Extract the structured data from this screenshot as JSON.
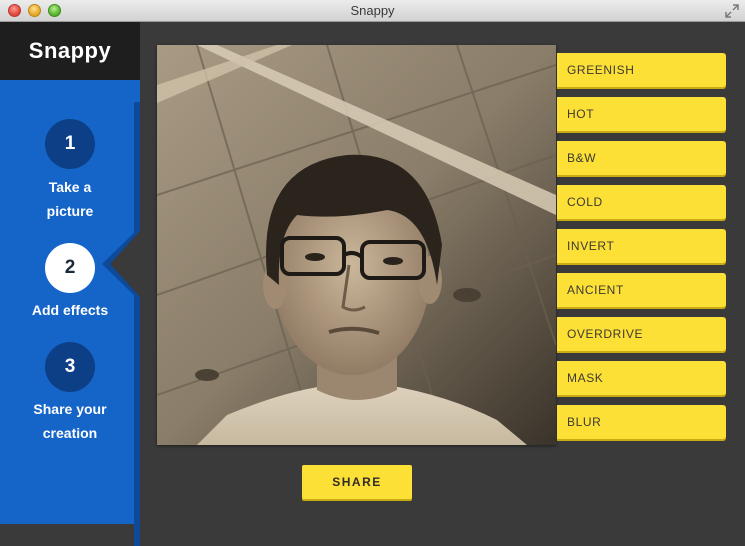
{
  "window": {
    "title": "Snappy"
  },
  "sidebar": {
    "brand": "Snappy",
    "steps": [
      {
        "number": "1",
        "line1": "Take a",
        "line2": "picture",
        "state": "inactive"
      },
      {
        "number": "2",
        "line1": "Add effects",
        "line2": "",
        "state": "active"
      },
      {
        "number": "3",
        "line1": "Share your",
        "line2": "creation",
        "state": "inactive"
      }
    ]
  },
  "photo": {
    "content": "webcam-snapshot"
  },
  "effects": [
    "GREENISH",
    "HOT",
    "B&W",
    "COLD",
    "INVERT",
    "ANCIENT",
    "OVERDRIVE",
    "MASK",
    "BLUR"
  ],
  "share": {
    "label": "SHARE"
  },
  "colors": {
    "sidebar": "#1565c8",
    "step_circle": "#0d3f86",
    "accent_yellow": "#fde035",
    "background": "#3a3a3a",
    "brand_bar": "#1e1e1e"
  },
  "icons": [
    "close-traffic-light",
    "minimize-traffic-light",
    "zoom-traffic-light",
    "fullscreen-icon"
  ]
}
